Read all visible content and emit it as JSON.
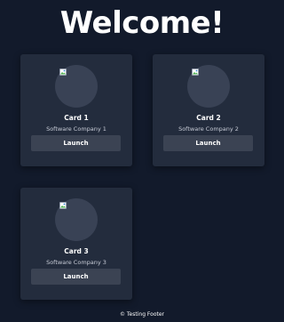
{
  "header": {
    "title": "Welcome!"
  },
  "cards": [
    {
      "title": "Card 1",
      "subtitle": "Software Company 1",
      "button_label": "Launch",
      "image_icon": "broken-image-icon"
    },
    {
      "title": "Card 2",
      "subtitle": "Software Company 2",
      "button_label": "Launch",
      "image_icon": "broken-image-icon"
    },
    {
      "title": "Card 3",
      "subtitle": "Software Company 3",
      "button_label": "Launch",
      "image_icon": "broken-image-icon"
    }
  ],
  "footer": {
    "text": "© Testing Footer"
  },
  "colors": {
    "background": "#121a2b",
    "card": "#232c3d",
    "button": "#3b4353",
    "avatar": "#394255"
  }
}
